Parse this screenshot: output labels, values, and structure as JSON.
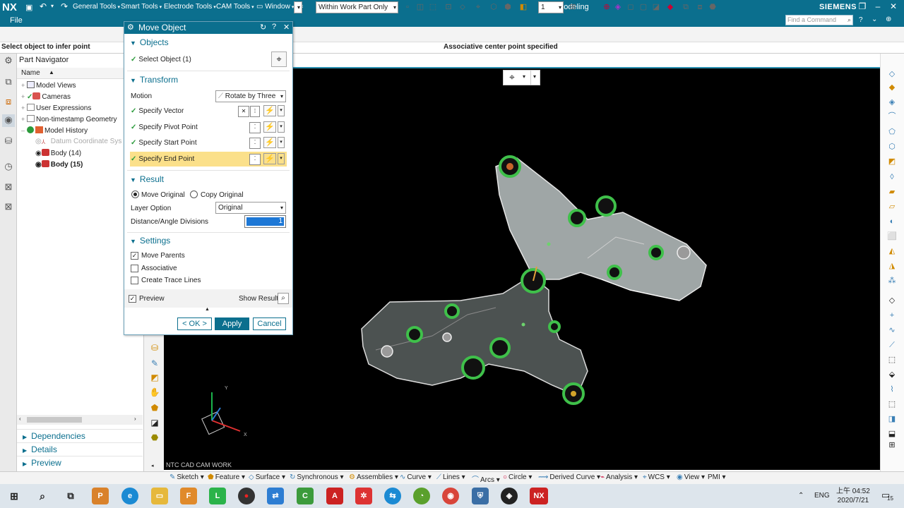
{
  "app": {
    "logo": "NX",
    "file_menu": "File",
    "title": "NX - Modeling",
    "brand": "SIEMENS",
    "find_placeholder": "Find a Command"
  },
  "quick_access": {
    "menus": [
      "General Tools",
      "Smart Tools",
      "Electrode Tools",
      "CAM Tools",
      "Window"
    ]
  },
  "toolbar": {
    "filter_value": "Within Work Part Only",
    "layer_value": "1"
  },
  "status": {
    "left": "Select object to infer point",
    "center": "Associative center point specified"
  },
  "part_navigator": {
    "title": "Part Navigator",
    "column_name": "Name",
    "items": [
      {
        "label": "Model Views",
        "bold": false,
        "dim": false
      },
      {
        "label": "Cameras",
        "bold": false,
        "dim": false
      },
      {
        "label": "User Expressions",
        "bold": false,
        "dim": false
      },
      {
        "label": "Non-timestamp Geometry",
        "bold": false,
        "dim": false
      },
      {
        "label": "Model History",
        "bold": false,
        "dim": false
      },
      {
        "label": "Datum Coordinate Sys",
        "bold": false,
        "dim": true
      },
      {
        "label": "Body (14)",
        "bold": false,
        "dim": false
      },
      {
        "label": "Body (15)",
        "bold": true,
        "dim": false
      }
    ],
    "panels": [
      "Dependencies",
      "Details",
      "Preview"
    ]
  },
  "dialog": {
    "title": "Move Object",
    "objects": {
      "section": "Objects",
      "select_label": "Select Object (1)"
    },
    "transform": {
      "section": "Transform",
      "motion_label": "Motion",
      "motion_value": "Rotate by Three",
      "specify_vector": "Specify Vector",
      "specify_pivot": "Specify Pivot Point",
      "specify_start": "Specify Start Point",
      "specify_end": "Specify End Point"
    },
    "result": {
      "section": "Result",
      "move_original": "Move Original",
      "copy_original": "Copy Original",
      "layer_option_label": "Layer Option",
      "layer_option_value": "Original",
      "divisions_label": "Distance/Angle Divisions",
      "divisions_value": "1"
    },
    "settings": {
      "section": "Settings",
      "move_parents": "Move Parents",
      "associative": "Associative",
      "create_trace": "Create Trace Lines",
      "move_parents_checked": true,
      "associative_checked": false,
      "create_trace_checked": false
    },
    "preview_label": "Preview",
    "preview_checked": true,
    "show_result_label": "Show Result",
    "buttons": {
      "ok": "< OK >",
      "apply": "Apply",
      "cancel": "Cancel"
    }
  },
  "viewport": {
    "watermark": "NTC CAD CAM WORK",
    "background": "#000000",
    "accent": "#2a8fb0"
  },
  "bottom_commands": [
    "Sketch",
    "Feature",
    "Surface",
    "Synchronous",
    "Assemblies",
    "Curve",
    "Lines",
    "Arcs",
    "Circle",
    "Derived Curve",
    "Analysis",
    "WCS",
    "View",
    "PMI"
  ],
  "taskbar": {
    "lang": "ENG",
    "time": "上午 04:52",
    "date": "2020/7/21",
    "notification_count": "15"
  },
  "colors": {
    "titlebar": "#0b6f8e",
    "dialog_highlight": "#fbe08a",
    "check_green": "#2a9a3a"
  }
}
